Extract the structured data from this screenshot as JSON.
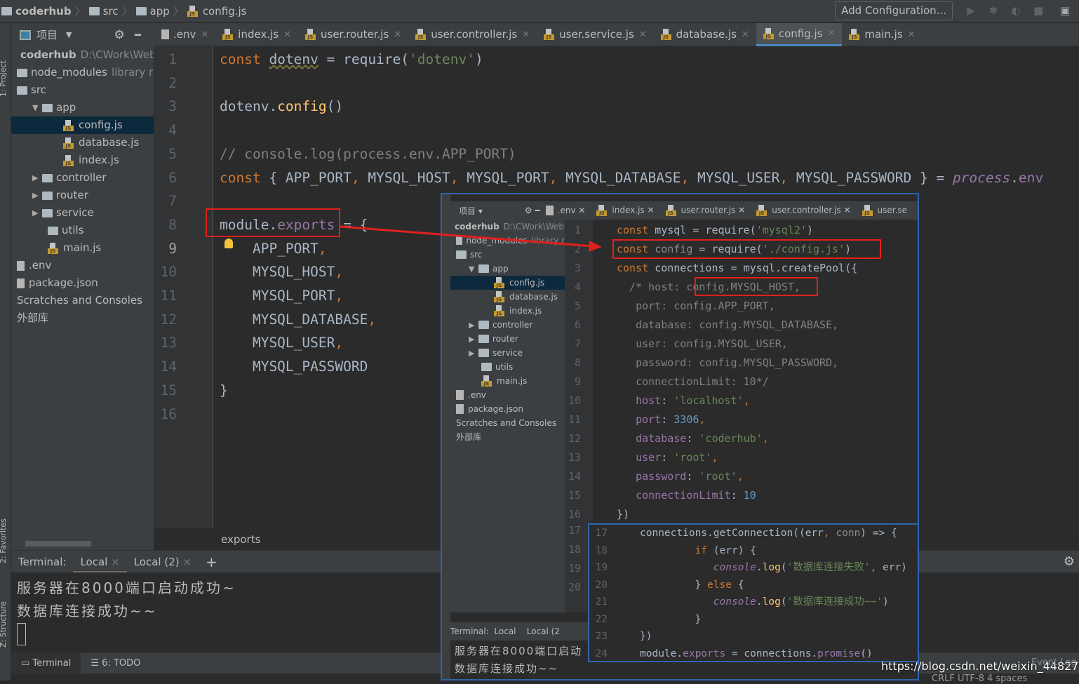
{
  "breadcrumb": [
    "coderhub",
    "src",
    "app",
    "config.js"
  ],
  "toolbar": {
    "add_config": "Add Configuration..."
  },
  "side_tools": {
    "project": "1: Project",
    "favorites": "2: Favorites",
    "structure": "Z: Structure"
  },
  "project": {
    "header": "项目",
    "root": "coderhub",
    "root_path": "D:\\CWork\\WebS",
    "items": [
      {
        "label": "node_modules",
        "extra": "library r",
        "type": "folder",
        "depth": 0,
        "arrow": ""
      },
      {
        "label": "src",
        "type": "folder",
        "depth": 0,
        "arrow": ""
      },
      {
        "label": "app",
        "type": "folder",
        "depth": 1,
        "arrow": "▼"
      },
      {
        "label": "config.js",
        "type": "js",
        "depth": 3,
        "selected": true
      },
      {
        "label": "database.js",
        "type": "js",
        "depth": 3
      },
      {
        "label": "index.js",
        "type": "js",
        "depth": 3
      },
      {
        "label": "controller",
        "type": "folder",
        "depth": 1,
        "arrow": "▶"
      },
      {
        "label": "router",
        "type": "folder",
        "depth": 1,
        "arrow": "▶"
      },
      {
        "label": "service",
        "type": "folder",
        "depth": 1,
        "arrow": "▶"
      },
      {
        "label": "utils",
        "type": "folder",
        "depth": 2
      },
      {
        "label": "main.js",
        "type": "js",
        "depth": 2
      },
      {
        "label": ".env",
        "type": "file",
        "depth": 0
      },
      {
        "label": "package.json",
        "type": "file",
        "depth": 0
      },
      {
        "label": "Scratches and Consoles",
        "type": "none",
        "depth": 0
      },
      {
        "label": "外部库",
        "type": "none",
        "depth": 0
      }
    ]
  },
  "tabs": [
    {
      "label": ".env",
      "icon": "file"
    },
    {
      "label": "index.js",
      "icon": "js"
    },
    {
      "label": "user.router.js",
      "icon": "js"
    },
    {
      "label": "user.controller.js",
      "icon": "js"
    },
    {
      "label": "user.service.js",
      "icon": "js"
    },
    {
      "label": "database.js",
      "icon": "js"
    },
    {
      "label": "config.js",
      "icon": "js",
      "active": true
    },
    {
      "label": "main.js",
      "icon": "js"
    }
  ],
  "editor": {
    "lines": [
      [
        [
          "const ",
          "kw"
        ],
        [
          "dotenv",
          "u"
        ],
        [
          " = require(",
          ""
        ],
        [
          "'dotenv'",
          "str"
        ],
        [
          ")",
          ""
        ]
      ],
      [],
      [
        [
          "dotenv.",
          ""
        ],
        [
          "config",
          "fn"
        ],
        [
          "()",
          ""
        ]
      ],
      [],
      [
        [
          "// console.log(process.env.APP_PORT)",
          "cm"
        ]
      ],
      [
        [
          "const ",
          "kw"
        ],
        [
          "{ APP_PORT",
          ""
        ],
        [
          ", ",
          "kw"
        ],
        [
          "MYSQL_HOST",
          ""
        ],
        [
          ", ",
          "kw"
        ],
        [
          "MYSQL_PORT",
          ""
        ],
        [
          ", ",
          "kw"
        ],
        [
          "MYSQL_DATABASE",
          ""
        ],
        [
          ", ",
          "kw"
        ],
        [
          "MYSQL_USER",
          ""
        ],
        [
          ", ",
          "kw"
        ],
        [
          "MYSQL_PASSWORD } = ",
          ""
        ],
        [
          "process",
          "it"
        ],
        [
          ".",
          ""
        ],
        [
          "env",
          "pu"
        ]
      ],
      [],
      [
        [
          "module.",
          ""
        ],
        [
          "exports",
          "pu"
        ],
        [
          " = {",
          ""
        ]
      ],
      [
        [
          "    APP_PORT",
          ""
        ],
        [
          ",",
          "kw"
        ]
      ],
      [
        [
          "    MYSQL_HOST",
          ""
        ],
        [
          ",",
          "kw"
        ]
      ],
      [
        [
          "    MYSQL_PORT",
          ""
        ],
        [
          ",",
          "kw"
        ]
      ],
      [
        [
          "    MYSQL_DATABASE",
          ""
        ],
        [
          ",",
          "kw"
        ]
      ],
      [
        [
          "    MYSQL_USER",
          ""
        ],
        [
          ",",
          "kw"
        ]
      ],
      [
        [
          "    MYSQL_PASSWORD",
          ""
        ]
      ],
      [
        [
          "}",
          ""
        ]
      ],
      []
    ],
    "breadcrumb": "exports"
  },
  "terminal": {
    "label": "Terminal:",
    "tabs": [
      "Local",
      "Local (2)"
    ],
    "lines": [
      "服务器在8000端口启动成功~",
      "数据库连接成功~~"
    ]
  },
  "bottom_tabs": [
    "Terminal",
    "6: TODO"
  ],
  "overlay": {
    "tabs": [
      ".env",
      "index.js",
      "user.router.js",
      "user.controller.js",
      "user.se"
    ],
    "terminal_tabs": [
      "Local",
      "Local (2"
    ],
    "terminal_lines": [
      "服务器在8000端口启动",
      "数据库连接成功~~"
    ],
    "lines": [
      [
        [
          "const ",
          "kw"
        ],
        [
          "mysql = require(",
          ""
        ],
        [
          "'mysql2'",
          "str"
        ],
        [
          ")",
          ""
        ]
      ],
      [
        [
          "const ",
          "kw"
        ],
        [
          "config",
          "gr"
        ],
        [
          " = require(",
          ""
        ],
        [
          "'./config.js'",
          "str"
        ],
        [
          ")",
          ""
        ]
      ],
      [
        [
          "const ",
          "kw"
        ],
        [
          "connections = mysql.createPool({",
          ""
        ]
      ],
      [
        [
          "  /* host: config.MYSQL_HOST,",
          "cm"
        ]
      ],
      [
        [
          "   port: config.APP_PORT,",
          "cm"
        ]
      ],
      [
        [
          "   database: config.MYSQL_DATABASE,",
          "cm"
        ]
      ],
      [
        [
          "   user: config.MYSQL_USER,",
          "cm"
        ]
      ],
      [
        [
          "   password: config.MYSQL_PASSWORD,",
          "cm"
        ]
      ],
      [
        [
          "   connectionLimit: 10*/",
          "cm"
        ]
      ],
      [
        [
          "   host",
          "pu"
        ],
        [
          ": ",
          ""
        ],
        [
          "'localhost'",
          "str"
        ],
        [
          ",",
          "kw"
        ]
      ],
      [
        [
          "   port",
          "pu"
        ],
        [
          ": ",
          ""
        ],
        [
          "3306",
          "num"
        ],
        [
          ",",
          "kw"
        ]
      ],
      [
        [
          "   database",
          "pu"
        ],
        [
          ": ",
          ""
        ],
        [
          "'coderhub'",
          "str"
        ],
        [
          ",",
          "kw"
        ]
      ],
      [
        [
          "   user",
          "pu"
        ],
        [
          ": ",
          ""
        ],
        [
          "'root'",
          "str"
        ],
        [
          ",",
          "kw"
        ]
      ],
      [
        [
          "   password",
          "pu"
        ],
        [
          ": ",
          ""
        ],
        [
          "'root'",
          "str"
        ],
        [
          ",",
          "kw"
        ]
      ],
      [
        [
          "   connectionLimit",
          "pu"
        ],
        [
          ": ",
          ""
        ],
        [
          "10",
          "num"
        ]
      ],
      [
        [
          "})",
          ""
        ]
      ]
    ],
    "lines2": [
      [
        [
          "connections.getConnection((err",
          ""
        ],
        [
          ", ",
          "kw"
        ],
        [
          "conn",
          "gr"
        ],
        [
          ") => {",
          ""
        ]
      ],
      [
        [
          "         ",
          ""
        ],
        [
          "if ",
          "kw"
        ],
        [
          "(err) {",
          ""
        ]
      ],
      [
        [
          "            ",
          ""
        ],
        [
          "console",
          "it"
        ],
        [
          ".",
          ""
        ],
        [
          "log",
          "fn"
        ],
        [
          "(",
          ""
        ],
        [
          "'数据库连接失败'",
          "str"
        ],
        [
          ", ",
          "kw"
        ],
        [
          "err)",
          ""
        ]
      ],
      [
        [
          "         } ",
          ""
        ],
        [
          "else ",
          "kw"
        ],
        [
          "{",
          ""
        ]
      ],
      [
        [
          "            ",
          ""
        ],
        [
          "console",
          "it"
        ],
        [
          ".",
          ""
        ],
        [
          "log",
          "fn"
        ],
        [
          "(",
          ""
        ],
        [
          "'数据库连接成功~~'",
          "str"
        ],
        [
          ")",
          ""
        ]
      ],
      [
        [
          "         }",
          ""
        ]
      ],
      [
        [
          "})",
          ""
        ]
      ],
      [
        [
          "module.",
          ""
        ],
        [
          "exports",
          "pu"
        ],
        [
          " = connections.",
          ""
        ],
        [
          "promise",
          "pu"
        ],
        [
          "()",
          ""
        ]
      ]
    ]
  },
  "watermark": "https://blog.csdn.net/weixin_44827418",
  "status": {
    "event_log": "Event Log",
    "encoding": "CRLF  UTF-8  4 spaces"
  }
}
